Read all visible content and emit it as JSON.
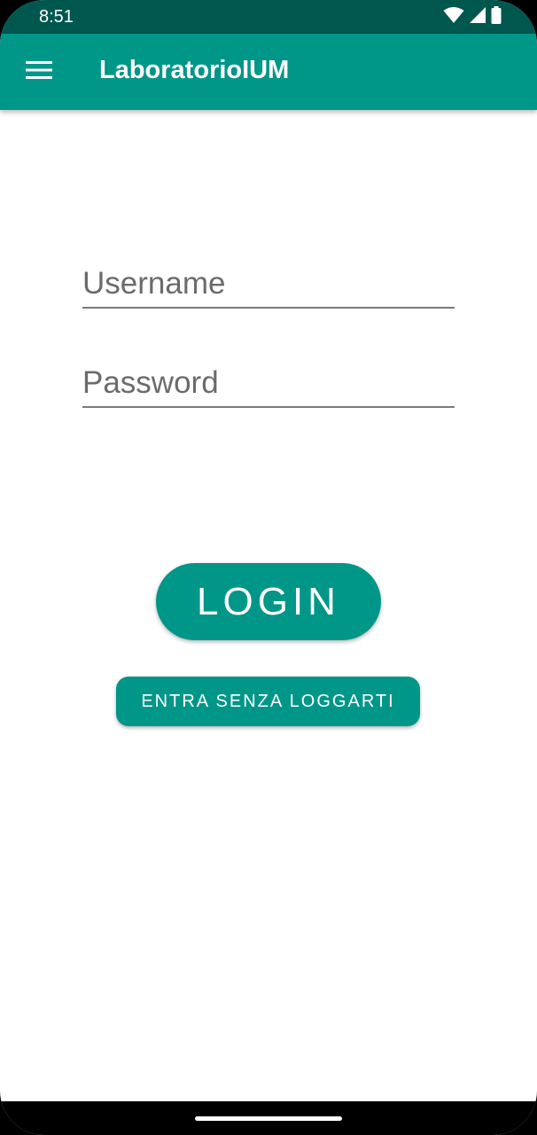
{
  "status_bar": {
    "time": "8:51",
    "icons": [
      "wifi-icon",
      "signal-icon",
      "battery-icon"
    ]
  },
  "app_bar": {
    "title": "LaboratorioIUM",
    "menu_icon": "hamburger-menu-icon"
  },
  "form": {
    "username_placeholder": "Username",
    "username_value": "",
    "password_placeholder": "Password",
    "password_value": ""
  },
  "buttons": {
    "login_label": "LOGIN",
    "guest_label": "ENTRA SENZA LOGGARTI"
  },
  "colors": {
    "primary": "#009688",
    "primary_dark": "#00574d",
    "background": "#ffffff"
  }
}
